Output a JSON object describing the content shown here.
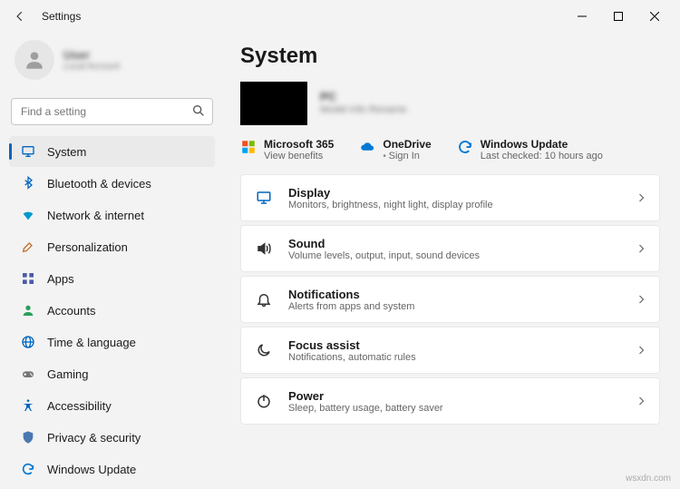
{
  "window": {
    "title": "Settings"
  },
  "profile": {
    "name": "User",
    "sub": "Local Account"
  },
  "search": {
    "placeholder": "Find a setting"
  },
  "sidebar": {
    "items": [
      {
        "label": "System",
        "icon": "display",
        "active": true
      },
      {
        "label": "Bluetooth & devices",
        "icon": "bluetooth",
        "active": false
      },
      {
        "label": "Network & internet",
        "icon": "wifi",
        "active": false
      },
      {
        "label": "Personalization",
        "icon": "brush",
        "active": false
      },
      {
        "label": "Apps",
        "icon": "apps",
        "active": false
      },
      {
        "label": "Accounts",
        "icon": "person",
        "active": false
      },
      {
        "label": "Time & language",
        "icon": "globe",
        "active": false
      },
      {
        "label": "Gaming",
        "icon": "game",
        "active": false
      },
      {
        "label": "Accessibility",
        "icon": "access",
        "active": false
      },
      {
        "label": "Privacy & security",
        "icon": "shield",
        "active": false
      },
      {
        "label": "Windows Update",
        "icon": "update",
        "active": false
      }
    ]
  },
  "main": {
    "heading": "System",
    "device": {
      "name": "PC",
      "sub": "Model info\nRename"
    },
    "quick": [
      {
        "title": "Microsoft 365",
        "sub": "View benefits",
        "icon": "ms365",
        "bullet": false
      },
      {
        "title": "OneDrive",
        "sub": "Sign In",
        "icon": "onedrive",
        "bullet": true
      },
      {
        "title": "Windows Update",
        "sub": "Last checked: 10 hours ago",
        "icon": "update",
        "bullet": false
      }
    ],
    "cards": [
      {
        "title": "Display",
        "sub": "Monitors, brightness, night light, display profile",
        "icon": "display"
      },
      {
        "title": "Sound",
        "sub": "Volume levels, output, input, sound devices",
        "icon": "sound"
      },
      {
        "title": "Notifications",
        "sub": "Alerts from apps and system",
        "icon": "bell"
      },
      {
        "title": "Focus assist",
        "sub": "Notifications, automatic rules",
        "icon": "moon"
      },
      {
        "title": "Power",
        "sub": "Sleep, battery usage, battery saver",
        "icon": "power"
      }
    ]
  },
  "watermark": "wsxdn.com"
}
